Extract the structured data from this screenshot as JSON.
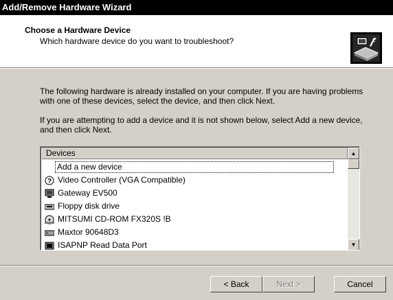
{
  "window": {
    "title": "Add/Remove Hardware Wizard"
  },
  "header": {
    "title": "Choose a Hardware Device",
    "subtitle": "Which hardware device do you want to troubleshoot?"
  },
  "body": {
    "paragraph1": "The following hardware is already installed on your computer. If you are having problems with one of these devices, select the device, and then click Next.",
    "paragraph2": "If you are attempting to add a device and it is not shown below, select Add a new device, and then click Next."
  },
  "devices": {
    "column_header": "Devices",
    "items": [
      {
        "label": "Add a new device",
        "icon": "none"
      },
      {
        "label": "Video Controller (VGA Compatible)",
        "icon": "unknown-device-icon"
      },
      {
        "label": "Gateway EV500",
        "icon": "monitor-icon"
      },
      {
        "label": "Floppy disk drive",
        "icon": "floppy-drive-icon"
      },
      {
        "label": "MITSUMI CD-ROM FX320S !B",
        "icon": "cdrom-icon"
      },
      {
        "label": "Maxtor 90648D3",
        "icon": "hard-disk-icon"
      },
      {
        "label": "ISAPNP Read Data Port",
        "icon": "system-device-icon"
      }
    ]
  },
  "buttons": {
    "back": "< Back",
    "next": "Next >",
    "cancel": "Cancel"
  }
}
